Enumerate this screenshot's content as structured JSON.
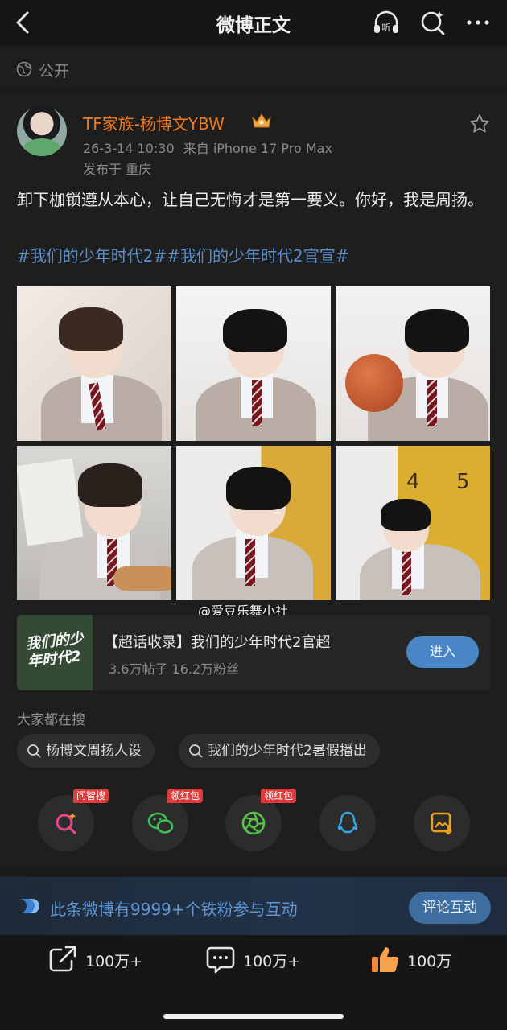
{
  "header": {
    "title": "微博正文"
  },
  "visibility": {
    "label": "公开"
  },
  "post": {
    "author": "TF家族-杨博文YBW",
    "timestamp": "26-3-14 10:30",
    "source": "来自 iPhone 17 Pro Max",
    "location": "发布于 重庆",
    "text": "卸下枷锁遵从本心，让自己无悔才是第一要义。你好，我是周扬。",
    "hashtags": "#我们的少年时代2##我们的少年时代2官宣#",
    "watermark": "@爱豆乐舞小社"
  },
  "supertopic": {
    "thumb_text": "我们的少年时代2",
    "title": "【超话收录】我们的少年时代2官超",
    "stats": "3.6万帖子 16.2万粉丝",
    "join_label": "进入"
  },
  "search": {
    "label": "大家都在搜",
    "chips": [
      "杨博文周扬人设",
      "我们的少年时代2暑假播出"
    ]
  },
  "share_targets": [
    {
      "icon": "ask-search-icon",
      "tag": "问智搜",
      "color": "#e8468a"
    },
    {
      "icon": "wechat-icon",
      "tag": "领红包",
      "color": "#3fbf5a"
    },
    {
      "icon": "moments-icon",
      "tag": "领红包",
      "color": "#56c44a"
    },
    {
      "icon": "qq-icon",
      "tag": "",
      "color": "#30a7e8"
    },
    {
      "icon": "save-image-icon",
      "tag": "",
      "color": "#e8a21f"
    }
  ],
  "fans_bar": {
    "text": "此条微博有9999+个铁粉参与互动",
    "button": "评论互动"
  },
  "actions": {
    "repost": "100万+",
    "comment": "100万+",
    "like": "100万"
  },
  "colors": {
    "accent_orange": "#ef7a1e",
    "link_blue": "#5b8ec9",
    "button_blue": "#4a86c5"
  }
}
